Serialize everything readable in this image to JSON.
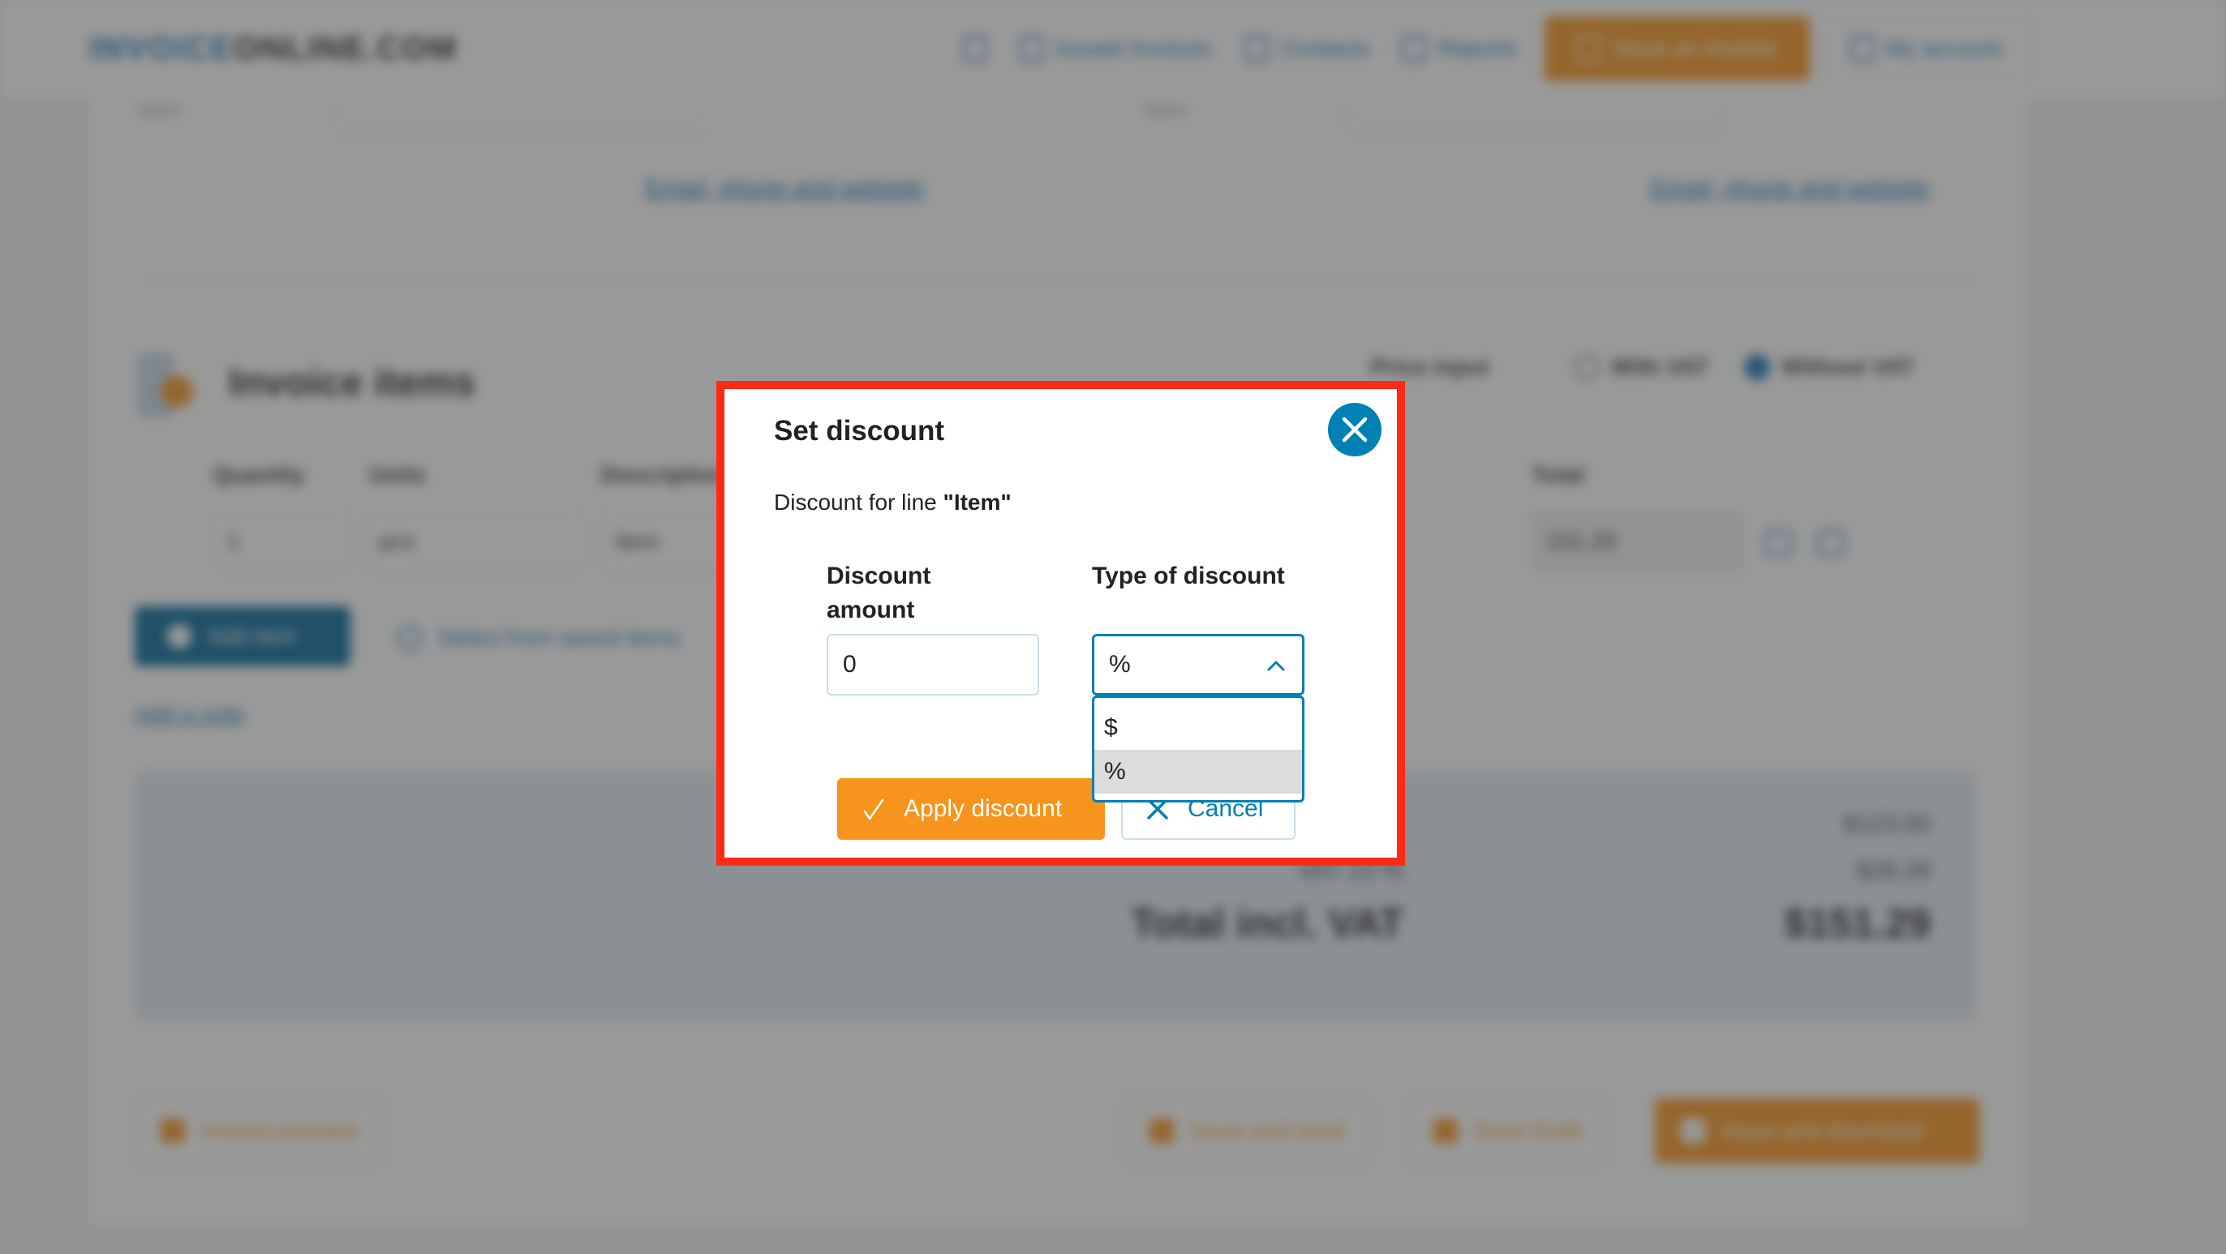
{
  "header": {
    "logo_part1": "INVOICE",
    "logo_part2": "ONLINE.COM",
    "nav": [
      {
        "label": "",
        "icon": "menu-icon"
      },
      {
        "label": "Issued Invoices",
        "icon": "document-icon"
      },
      {
        "label": "Contacts",
        "icon": "contacts-icon"
      },
      {
        "label": "Reports",
        "icon": "reports-icon"
      }
    ],
    "cta_label": "Issue an Invoice",
    "account_label": "My account"
  },
  "page": {
    "supplier_name_label": "Name",
    "customer_name_label": "Name",
    "email_link_supplier": "Email, phone and website",
    "email_link_customer": "Email, phone and website",
    "items_title": "Invoice items",
    "price_input_label": "Price input",
    "radio_with_vat": "With VAT",
    "radio_without_vat": "Without VAT",
    "selected_price_mode": "Without VAT",
    "columns": [
      "Quantity",
      "Units",
      "Description",
      "",
      "",
      "Total"
    ],
    "row": {
      "quantity": "1",
      "units": "pcs",
      "description": "Item",
      "total": "151.29"
    },
    "add_item_label": "Add item",
    "saved_items_label": "Select from saved items",
    "add_note_label": "Add a note",
    "totals": {
      "subtotal": "$123.00",
      "vat_label": "VAT 23 %",
      "vat_value": "$28.29",
      "total_label": "Total incl. VAT",
      "total_value": "$151.29"
    },
    "footer": {
      "preview_label": "Invoice preview",
      "issue_send_label": "Issue and send",
      "save_draft_label": "Save Draft",
      "issue_download_label": "Issue and download"
    }
  },
  "modal": {
    "title": "Set discount",
    "subtitle_prefix": "Discount for line ",
    "line_name": "\"Item\"",
    "amount_label": "Discount amount",
    "amount_value": "0",
    "type_label": "Type of discount",
    "type_selected": "%",
    "type_options": [
      "$",
      "%"
    ],
    "highlighted_option": "%",
    "apply_label": "Apply discount",
    "cancel_label": "Cancel",
    "colors": {
      "accent": "#0080b4",
      "apply": "#f7941d",
      "highlight_frame": "#ff2a16"
    }
  }
}
